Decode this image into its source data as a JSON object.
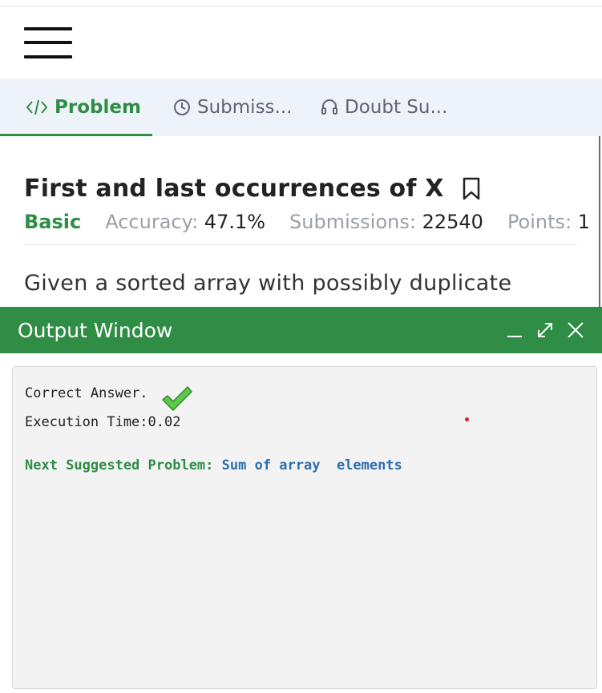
{
  "tabs": [
    {
      "label": "Problem",
      "icon": "code-icon",
      "active": true
    },
    {
      "label": "Submiss...",
      "icon": "clock-icon",
      "active": false
    },
    {
      "label": "Doubt Su...",
      "icon": "headset-icon",
      "active": false
    }
  ],
  "problem": {
    "title": "First and last occurrences of X",
    "difficulty": "Basic",
    "accuracy_label": "Accuracy:",
    "accuracy_value": "47.1%",
    "submissions_label": "Submissions:",
    "submissions_value": "22540",
    "points_label": "Points:",
    "points_value": "1",
    "description": "Given a sorted array with possibly duplicate"
  },
  "output_window": {
    "title": "Output Window",
    "result": "Correct Answer.",
    "execution_time": "Execution Time:0.02",
    "next_label": "Next Suggested Problem:",
    "next_problem": "Sum of array  elements"
  },
  "colors": {
    "accent_green": "#2f8d46",
    "link_blue": "#2c6fae"
  }
}
